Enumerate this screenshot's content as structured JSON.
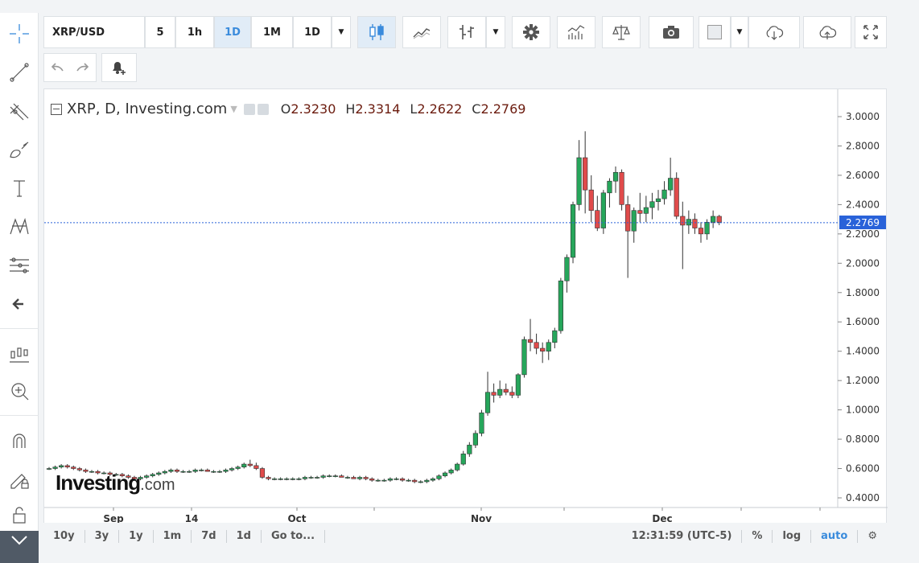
{
  "toolbar": {
    "symbol": "XRP/USD",
    "intervals": [
      "5",
      "1h",
      "1D",
      "1M",
      "1D"
    ],
    "active_interval_index": 2
  },
  "icons": {
    "left_tools": [
      "crosshair-icon",
      "trend-line-icon",
      "fib-tools-icon",
      "brush-icon",
      "text-icon",
      "pattern-icon",
      "measure-icon",
      "back-arrow-icon",
      "indicators-icon",
      "zoom-in-icon",
      "magnet-icon",
      "lock-drawing-icon",
      "lock-icon"
    ],
    "top_tools": [
      "candles-icon",
      "area-icon",
      "bars-icon",
      "settings-gear-icon",
      "indicators-icon",
      "compare-scales-icon",
      "camera-icon",
      "color-box-icon",
      "cloud-download-icon",
      "cloud-upload-icon",
      "fullscreen-icon"
    ]
  },
  "legend": {
    "title": "XRP, D, Investing.com",
    "open_label": "O",
    "open": "2.3230",
    "high_label": "H",
    "high": "2.3314",
    "low_label": "L",
    "low": "2.2622",
    "close_label": "C",
    "close": "2.2769"
  },
  "brand": {
    "name": "Investing",
    "suffix": ".com"
  },
  "last_price": "2.2769",
  "colors": {
    "up": "#26a65b",
    "down": "#e04b4b",
    "price_line": "#2962d9",
    "accent": "#3a8bdc"
  },
  "y_axis_ticks": [
    "3.0000",
    "2.8000",
    "2.6000",
    "2.4000",
    "2.2000",
    "2.0000",
    "1.8000",
    "1.6000",
    "1.4000",
    "1.2000",
    "1.0000",
    "0.8000",
    "0.6000",
    "0.4000"
  ],
  "x_axis_labels": [
    "Sep",
    "14",
    "Oct",
    "Nov",
    "Dec"
  ],
  "bottom_bar": {
    "ranges": [
      "10y",
      "3y",
      "1y",
      "1m",
      "7d",
      "1d",
      "Go to..."
    ],
    "time": "12:31:59 (UTC-5)",
    "percent": "%",
    "log": "log",
    "auto": "auto"
  },
  "chart_data": {
    "type": "candlestick",
    "title": "XRP, D, Investing.com",
    "ylim": [
      0.35,
      3.1
    ],
    "candles": [
      [
        0.6,
        0.61,
        0.59,
        0.6
      ],
      [
        0.6,
        0.62,
        0.59,
        0.61
      ],
      [
        0.61,
        0.63,
        0.6,
        0.62
      ],
      [
        0.62,
        0.63,
        0.6,
        0.61
      ],
      [
        0.61,
        0.62,
        0.59,
        0.6
      ],
      [
        0.6,
        0.61,
        0.58,
        0.59
      ],
      [
        0.59,
        0.6,
        0.57,
        0.58
      ],
      [
        0.58,
        0.59,
        0.57,
        0.58
      ],
      [
        0.58,
        0.59,
        0.56,
        0.57
      ],
      [
        0.57,
        0.58,
        0.56,
        0.57
      ],
      [
        0.57,
        0.58,
        0.55,
        0.56
      ],
      [
        0.56,
        0.57,
        0.55,
        0.56
      ],
      [
        0.56,
        0.57,
        0.54,
        0.55
      ],
      [
        0.55,
        0.56,
        0.53,
        0.54
      ],
      [
        0.54,
        0.55,
        0.52,
        0.53
      ],
      [
        0.53,
        0.55,
        0.52,
        0.54
      ],
      [
        0.54,
        0.56,
        0.53,
        0.55
      ],
      [
        0.55,
        0.57,
        0.54,
        0.56
      ],
      [
        0.56,
        0.58,
        0.55,
        0.57
      ],
      [
        0.57,
        0.59,
        0.56,
        0.58
      ],
      [
        0.58,
        0.6,
        0.57,
        0.59
      ],
      [
        0.59,
        0.6,
        0.57,
        0.58
      ],
      [
        0.58,
        0.59,
        0.57,
        0.58
      ],
      [
        0.58,
        0.59,
        0.57,
        0.58
      ],
      [
        0.58,
        0.6,
        0.57,
        0.59
      ],
      [
        0.59,
        0.6,
        0.58,
        0.59
      ],
      [
        0.59,
        0.6,
        0.58,
        0.58
      ],
      [
        0.58,
        0.59,
        0.57,
        0.58
      ],
      [
        0.58,
        0.59,
        0.57,
        0.58
      ],
      [
        0.58,
        0.6,
        0.57,
        0.59
      ],
      [
        0.59,
        0.61,
        0.58,
        0.6
      ],
      [
        0.6,
        0.62,
        0.59,
        0.61
      ],
      [
        0.61,
        0.64,
        0.6,
        0.63
      ],
      [
        0.63,
        0.66,
        0.61,
        0.62
      ],
      [
        0.62,
        0.64,
        0.59,
        0.6
      ],
      [
        0.6,
        0.61,
        0.53,
        0.54
      ],
      [
        0.54,
        0.55,
        0.52,
        0.53
      ],
      [
        0.53,
        0.54,
        0.52,
        0.53
      ],
      [
        0.53,
        0.54,
        0.52,
        0.53
      ],
      [
        0.53,
        0.54,
        0.52,
        0.53
      ],
      [
        0.53,
        0.54,
        0.52,
        0.53
      ],
      [
        0.53,
        0.54,
        0.52,
        0.53
      ],
      [
        0.53,
        0.55,
        0.52,
        0.54
      ],
      [
        0.54,
        0.55,
        0.53,
        0.54
      ],
      [
        0.54,
        0.55,
        0.53,
        0.54
      ],
      [
        0.54,
        0.56,
        0.53,
        0.55
      ],
      [
        0.55,
        0.56,
        0.54,
        0.55
      ],
      [
        0.55,
        0.56,
        0.54,
        0.55
      ],
      [
        0.55,
        0.56,
        0.54,
        0.54
      ],
      [
        0.54,
        0.55,
        0.53,
        0.54
      ],
      [
        0.54,
        0.55,
        0.53,
        0.53
      ],
      [
        0.53,
        0.55,
        0.52,
        0.54
      ],
      [
        0.54,
        0.55,
        0.52,
        0.53
      ],
      [
        0.53,
        0.54,
        0.51,
        0.52
      ],
      [
        0.52,
        0.53,
        0.51,
        0.52
      ],
      [
        0.52,
        0.53,
        0.51,
        0.52
      ],
      [
        0.52,
        0.54,
        0.51,
        0.53
      ],
      [
        0.53,
        0.54,
        0.52,
        0.53
      ],
      [
        0.53,
        0.54,
        0.51,
        0.52
      ],
      [
        0.52,
        0.53,
        0.51,
        0.52
      ],
      [
        0.52,
        0.53,
        0.5,
        0.51
      ],
      [
        0.51,
        0.52,
        0.5,
        0.51
      ],
      [
        0.51,
        0.53,
        0.5,
        0.52
      ],
      [
        0.52,
        0.54,
        0.51,
        0.53
      ],
      [
        0.53,
        0.56,
        0.52,
        0.55
      ],
      [
        0.55,
        0.58,
        0.54,
        0.57
      ],
      [
        0.57,
        0.6,
        0.56,
        0.59
      ],
      [
        0.59,
        0.64,
        0.58,
        0.63
      ],
      [
        0.63,
        0.72,
        0.62,
        0.7
      ],
      [
        0.7,
        0.78,
        0.68,
        0.76
      ],
      [
        0.76,
        0.86,
        0.74,
        0.84
      ],
      [
        0.84,
        1.0,
        0.82,
        0.98
      ],
      [
        0.98,
        1.26,
        0.96,
        1.12
      ],
      [
        1.12,
        1.18,
        1.05,
        1.1
      ],
      [
        1.1,
        1.2,
        1.08,
        1.14
      ],
      [
        1.14,
        1.18,
        1.1,
        1.12
      ],
      [
        1.12,
        1.16,
        1.08,
        1.1
      ],
      [
        1.1,
        1.25,
        1.08,
        1.24
      ],
      [
        1.24,
        1.5,
        1.22,
        1.48
      ],
      [
        1.48,
        1.62,
        1.4,
        1.46
      ],
      [
        1.46,
        1.52,
        1.38,
        1.42
      ],
      [
        1.42,
        1.46,
        1.32,
        1.4
      ],
      [
        1.4,
        1.48,
        1.34,
        1.46
      ],
      [
        1.46,
        1.56,
        1.42,
        1.54
      ],
      [
        1.54,
        1.9,
        1.52,
        1.88
      ],
      [
        1.88,
        2.06,
        1.8,
        2.04
      ],
      [
        2.04,
        2.42,
        2.0,
        2.4
      ],
      [
        2.4,
        2.84,
        2.36,
        2.72
      ],
      [
        2.72,
        2.9,
        2.34,
        2.5
      ],
      [
        2.5,
        2.6,
        2.28,
        2.36
      ],
      [
        2.36,
        2.46,
        2.22,
        2.24
      ],
      [
        2.24,
        2.5,
        2.2,
        2.48
      ],
      [
        2.48,
        2.58,
        2.38,
        2.56
      ],
      [
        2.56,
        2.66,
        2.48,
        2.62
      ],
      [
        2.62,
        2.64,
        2.36,
        2.4
      ],
      [
        2.4,
        2.46,
        1.9,
        2.22
      ],
      [
        2.22,
        2.38,
        2.14,
        2.36
      ],
      [
        2.36,
        2.48,
        2.28,
        2.34
      ],
      [
        2.34,
        2.46,
        2.28,
        2.38
      ],
      [
        2.38,
        2.48,
        2.3,
        2.42
      ],
      [
        2.42,
        2.5,
        2.36,
        2.44
      ],
      [
        2.44,
        2.56,
        2.4,
        2.5
      ],
      [
        2.5,
        2.72,
        2.46,
        2.58
      ],
      [
        2.58,
        2.62,
        2.3,
        2.32
      ],
      [
        2.32,
        2.42,
        1.96,
        2.26
      ],
      [
        2.26,
        2.36,
        2.2,
        2.3
      ],
      [
        2.3,
        2.34,
        2.2,
        2.24
      ],
      [
        2.24,
        2.28,
        2.14,
        2.2
      ],
      [
        2.2,
        2.3,
        2.16,
        2.28
      ],
      [
        2.28,
        2.36,
        2.24,
        2.32
      ],
      [
        2.32,
        2.33,
        2.26,
        2.28
      ]
    ]
  }
}
